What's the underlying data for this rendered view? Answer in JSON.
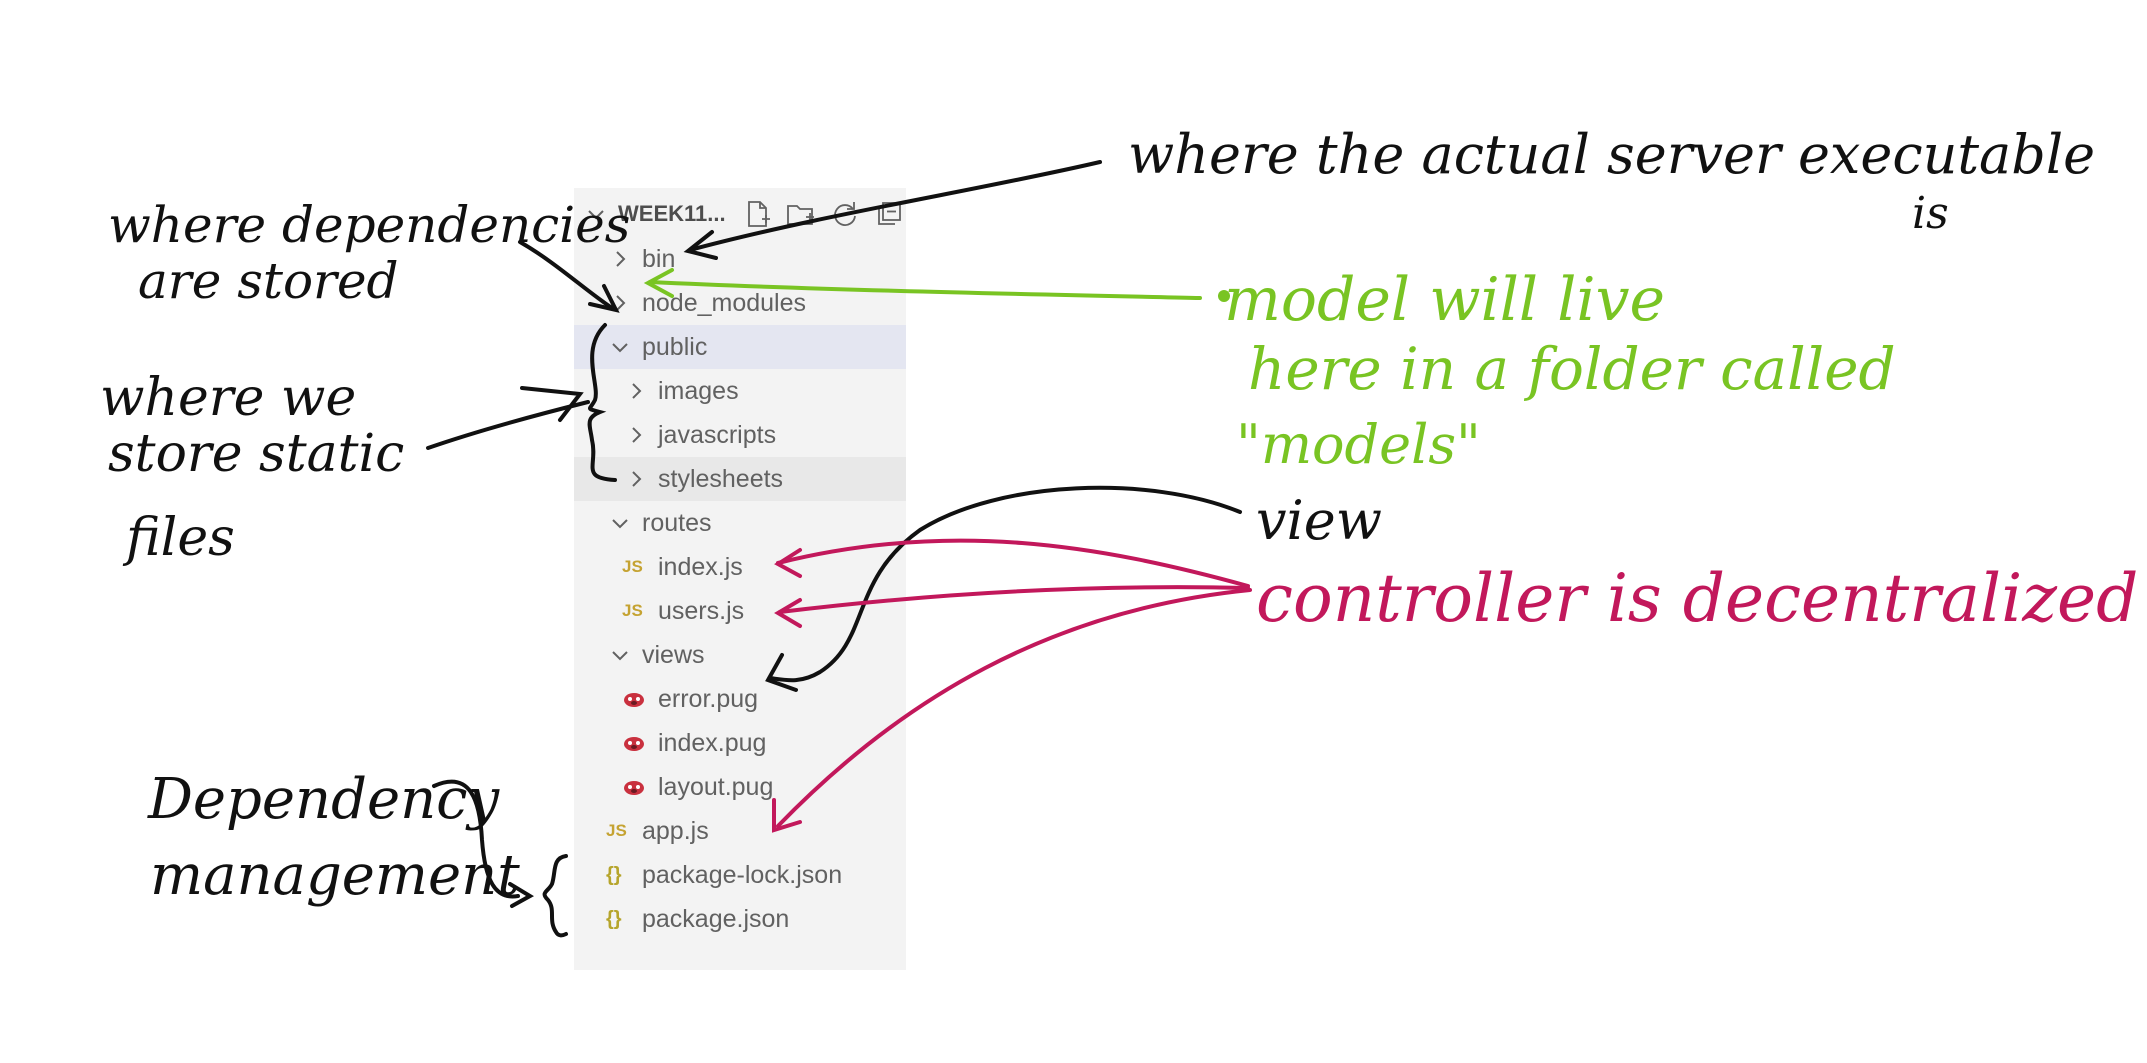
{
  "explorer": {
    "title": "WEEK11...",
    "toolbar": [
      {
        "name": "new-file-icon"
      },
      {
        "name": "new-folder-icon"
      },
      {
        "name": "refresh-icon"
      },
      {
        "name": "collapse-all-icon"
      }
    ],
    "items": [
      {
        "label": "bin"
      },
      {
        "label": "node_modules"
      },
      {
        "label": "public"
      },
      {
        "label": "images"
      },
      {
        "label": "javascripts"
      },
      {
        "label": "stylesheets"
      },
      {
        "label": "routes"
      },
      {
        "label": "index.js",
        "icon_text": "JS"
      },
      {
        "label": "users.js",
        "icon_text": "JS"
      },
      {
        "label": "views"
      },
      {
        "label": "error.pug"
      },
      {
        "label": "index.pug"
      },
      {
        "label": "layout.pug"
      },
      {
        "label": "app.js",
        "icon_text": "JS"
      },
      {
        "label": "package-lock.json",
        "icon_text": "{}"
      },
      {
        "label": "package.json",
        "icon_text": "{}"
      }
    ]
  },
  "annotations": {
    "server_exec": {
      "line1": "where the actual server executable",
      "line2": "is"
    },
    "dependencies": {
      "line1": "where dependencies",
      "line2": "are stored"
    },
    "static": {
      "line1": "where we",
      "line2": "store static",
      "line3": "files"
    },
    "model": {
      "line1": "model will live",
      "line2": "here in a folder called",
      "line3": "\"models\""
    },
    "view": "view",
    "controller": "controller is decentralized",
    "dependency_mgmt": {
      "line1": "Dependency",
      "line2": "management"
    }
  },
  "colors": {
    "ink_black": "#111111",
    "ink_green": "#79c423",
    "ink_red": "#c2185b",
    "highlight": "#f7b48a",
    "panel_bg": "#f3f3f3",
    "selected_bg": "#e4e6f1"
  }
}
